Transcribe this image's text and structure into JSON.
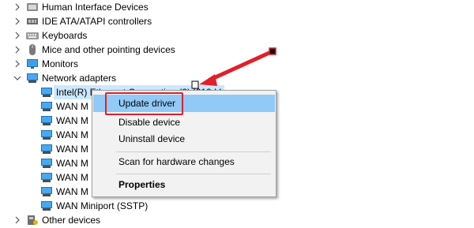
{
  "tree": {
    "categories": [
      {
        "label": "Human Interface Devices",
        "icon": "hid-icon",
        "expanded": false
      },
      {
        "label": "IDE ATA/ATAPI controllers",
        "icon": "ide-controller-icon",
        "expanded": false
      },
      {
        "label": "Keyboards",
        "icon": "keyboard-icon",
        "expanded": false
      },
      {
        "label": "Mice and other pointing devices",
        "icon": "mouse-icon",
        "expanded": false
      },
      {
        "label": "Monitors",
        "icon": "monitor-icon",
        "expanded": false
      },
      {
        "label": "Network adapters",
        "icon": "network-adapter-icon",
        "expanded": true
      }
    ],
    "network_children": [
      "Intel(R) Ethernet Connection (2) I219-V",
      "WAN M",
      "WAN M",
      "WAN M",
      "WAN M",
      "WAN M",
      "WAN M",
      "WAN M",
      "WAN M",
      "WAN Miniport (SSTP)"
    ],
    "other": {
      "label": "Other devices",
      "icon": "other-devices-icon",
      "expanded": false
    }
  },
  "context_menu": {
    "items": [
      "Update driver",
      "Disable device",
      "Uninstall device",
      "Scan for hardware changes",
      "Properties"
    ],
    "highlighted": "Update driver"
  },
  "colors": {
    "selection": "#cce8ff",
    "menu_highlight": "#91c9f7",
    "annotation_red": "#e0202a"
  }
}
